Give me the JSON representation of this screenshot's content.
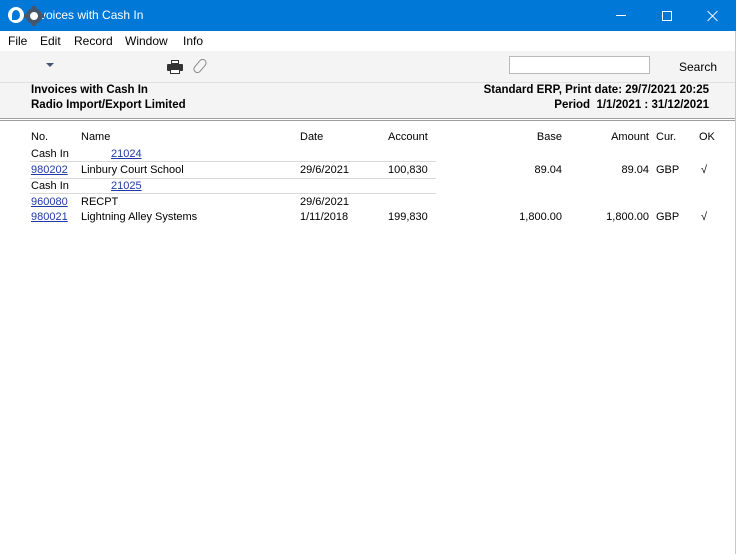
{
  "window": {
    "title": "Invoices with Cash In"
  },
  "menu": [
    "File",
    "Edit",
    "Record",
    "Window",
    "Info"
  ],
  "toolbar": {
    "search_label": "Search",
    "search_value": ""
  },
  "report": {
    "title": "Invoices with Cash In",
    "company": "Radio Import/Export Limited",
    "print_info": "Standard ERP, Print date: 29/7/2021 20:25",
    "period": "Period  1/1/2021 : 31/12/2021"
  },
  "columns": {
    "no": "No.",
    "name": "Name",
    "date": "Date",
    "account": "Account",
    "base": "Base",
    "amount": "Amount",
    "cur": "Cur.",
    "ok": "OK"
  },
  "groups": [
    {
      "label": "Cash In",
      "number": "21024",
      "rows": [
        {
          "no": "980202",
          "name": "Linbury Court School",
          "date": "29/6/2021",
          "account": "100,830",
          "base": "89.04",
          "amount": "89.04",
          "cur": "GBP",
          "ok": "√"
        }
      ]
    },
    {
      "label": "Cash In",
      "number": "21025",
      "rows": [
        {
          "no": "960080",
          "name": "RECPT",
          "date": "29/6/2021",
          "account": "",
          "base": "",
          "amount": "",
          "cur": "",
          "ok": ""
        },
        {
          "no": "980021",
          "name": "Lightning Alley Systems",
          "date": "1/11/2018",
          "account": "199,830",
          "base": "1,800.00",
          "amount": "1,800.00",
          "cur": "GBP",
          "ok": "√"
        }
      ]
    }
  ]
}
